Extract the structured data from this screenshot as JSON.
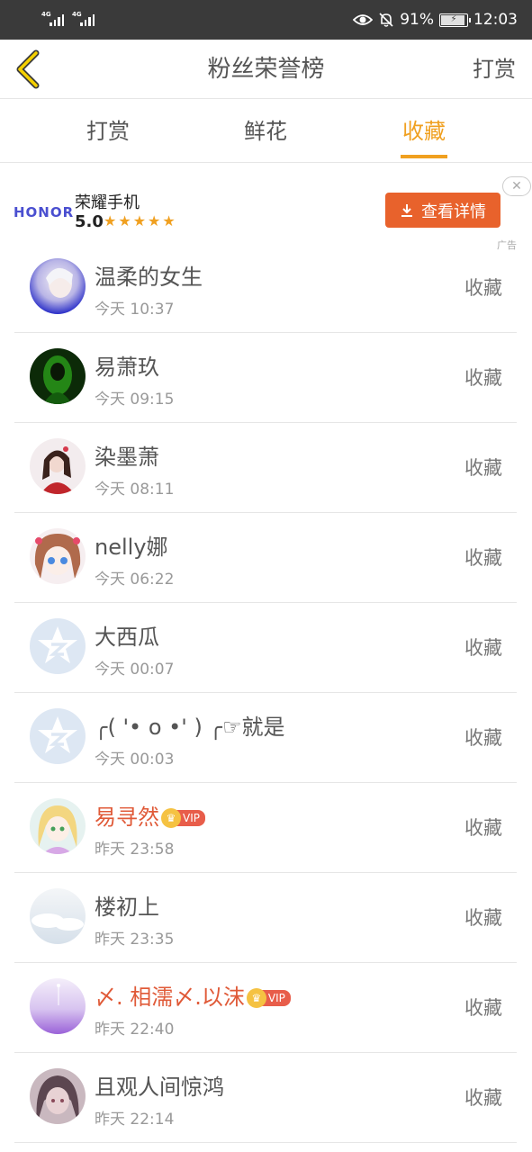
{
  "status_bar": {
    "signal1_label": "4G",
    "signal2_label": "4G",
    "battery_percent": "91%",
    "time": "12:03"
  },
  "nav": {
    "title": "粉丝荣誉榜",
    "action_label": "打赏"
  },
  "tabs": [
    {
      "label": "打赏",
      "active": false
    },
    {
      "label": "鲜花",
      "active": false
    },
    {
      "label": "收藏",
      "active": true
    }
  ],
  "accent_color": "#f0a020",
  "ad": {
    "brand": "HONOR",
    "app_name": "荣耀手机",
    "rating": "5.0",
    "stars": "★★★★★",
    "cta_label": "查看详情",
    "ad_label": "广告"
  },
  "fans": [
    {
      "name": "温柔的女生",
      "time": "今天 10:37",
      "action": "收藏",
      "vip": false,
      "avatar": "photo-blue"
    },
    {
      "name": "易萧玖",
      "time": "今天 09:15",
      "action": "收藏",
      "vip": false,
      "avatar": "photo-green"
    },
    {
      "name": "染墨萧",
      "time": "今天 08:11",
      "action": "收藏",
      "vip": false,
      "avatar": "photo-girl-red"
    },
    {
      "name": "nelly娜",
      "time": "今天 06:22",
      "action": "收藏",
      "vip": false,
      "avatar": "anime-girl"
    },
    {
      "name": "大西瓜",
      "time": "今天 00:07",
      "action": "收藏",
      "vip": false,
      "avatar": "default-star"
    },
    {
      "name": "╭( '• o •' ) ╭☞就是",
      "time": "今天 00:03",
      "action": "收藏",
      "vip": false,
      "avatar": "default-star"
    },
    {
      "name": "易寻然",
      "time": "昨天 23:58",
      "action": "收藏",
      "vip": true,
      "vip_label": "VIP",
      "avatar": "anime-blonde"
    },
    {
      "name": "楼初上",
      "time": "昨天 23:35",
      "action": "收藏",
      "vip": false,
      "avatar": "photo-cloud"
    },
    {
      "name": "〆. 相濡〆.以沫",
      "time": "昨天 22:40",
      "action": "收藏",
      "vip": true,
      "vip_label": "VIP",
      "avatar": "photo-lavender"
    },
    {
      "name": "且观人间惊鸿",
      "time": "昨天 22:14",
      "action": "收藏",
      "vip": false,
      "avatar": "anime-dark"
    }
  ]
}
